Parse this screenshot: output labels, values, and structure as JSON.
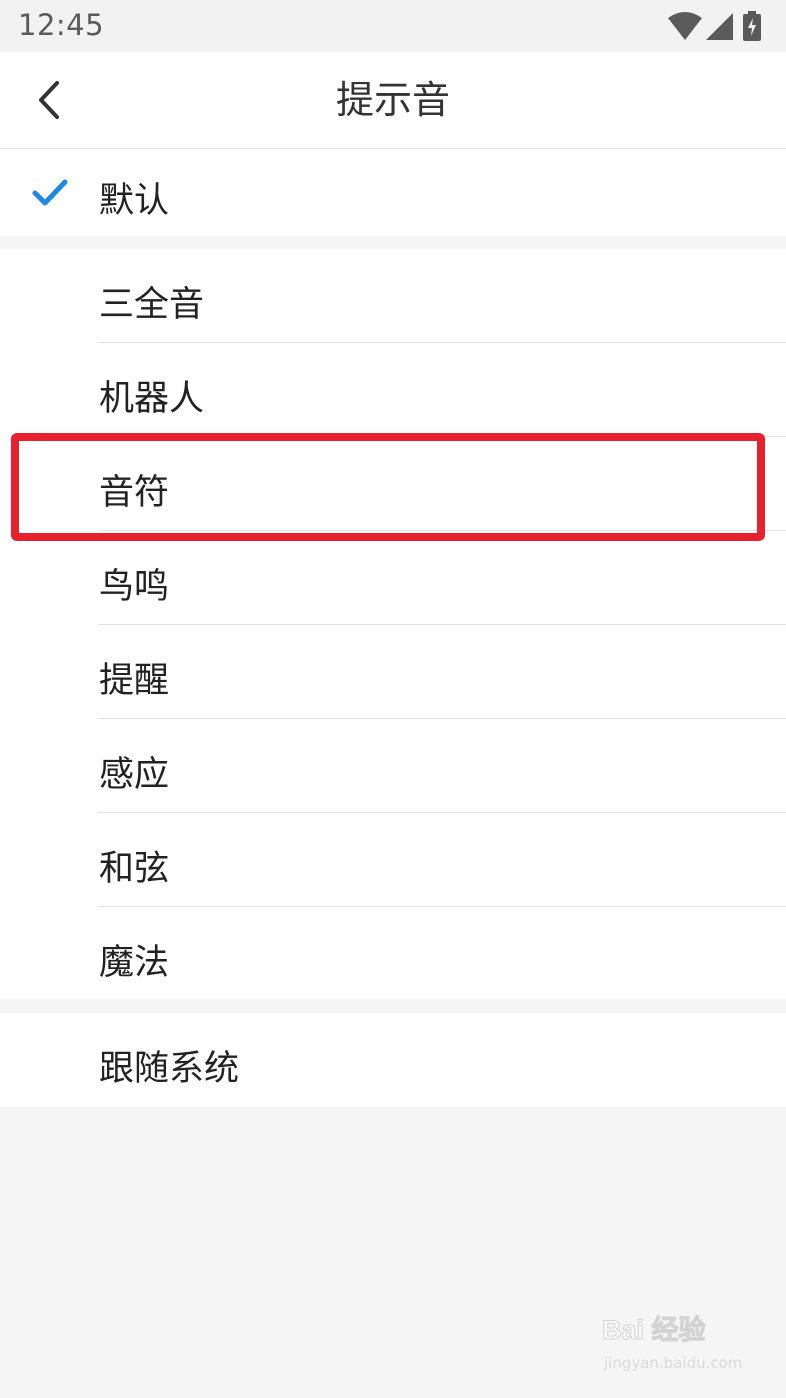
{
  "status_bar": {
    "time": "12:45",
    "icons": [
      "wifi-icon",
      "cell-signal-icon",
      "battery-charging-icon"
    ]
  },
  "header": {
    "title": "提示音",
    "back_icon": "chevron-left-icon"
  },
  "default_option": {
    "label": "默认",
    "selected": true,
    "check_color": "#1e88e5"
  },
  "sound_options": [
    {
      "label": "三全音"
    },
    {
      "label": "机器人"
    },
    {
      "label": "音符"
    },
    {
      "label": "鸟鸣"
    },
    {
      "label": "提醒"
    },
    {
      "label": "感应"
    },
    {
      "label": "和弦"
    },
    {
      "label": "魔法"
    }
  ],
  "follow_system": {
    "label": "跟随系统"
  },
  "annotation": {
    "highlight_color": "#e8212e"
  },
  "watermark": {
    "brand_text": "Bai 经验",
    "url": "jingyan.baidu.com"
  }
}
